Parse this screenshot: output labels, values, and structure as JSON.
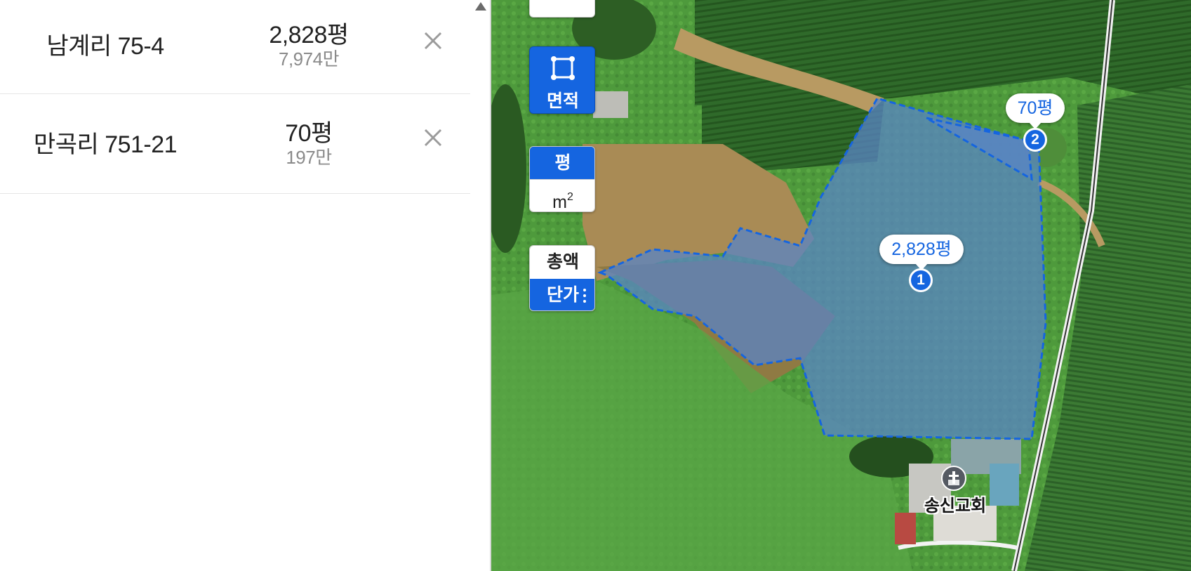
{
  "parcels": [
    {
      "index": "1",
      "name": "남계리 75-4",
      "area": "2,828평",
      "price": "7,974만",
      "map_label": "2,828평"
    },
    {
      "index": "2",
      "name": "만곡리 751-21",
      "area": "70평",
      "price": "197만",
      "map_label": "70평"
    }
  ],
  "controls": {
    "area_tool_label": "면적",
    "unit_pyeong": "평",
    "unit_sqm": "m",
    "unit_sqm_sup": "2",
    "price_total": "총액",
    "price_unit": "단가"
  },
  "map": {
    "poi_name": "송신교회",
    "poi_icon": "church-icon",
    "selection_color": "#1565e0"
  },
  "icons": {
    "remove": "close-icon",
    "area_tool": "polygon-select-icon",
    "scroll": "scroll-up-arrow-icon"
  }
}
